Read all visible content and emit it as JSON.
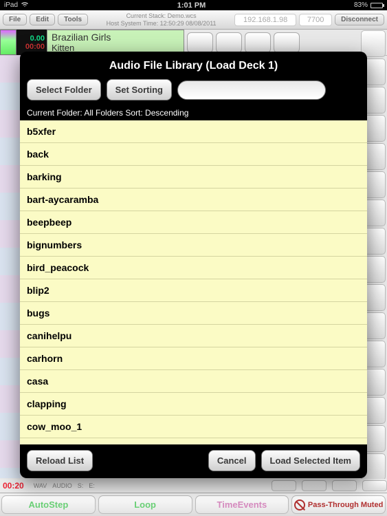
{
  "status_bar": {
    "carrier": "iPad",
    "time": "1:01 PM",
    "battery_pct": "83%"
  },
  "top_toolbar": {
    "file": "File",
    "edit": "Edit",
    "tools": "Tools",
    "stack_label": "Current Stack: Demo.wcs",
    "host_time": "Host System Time: 12:50:29  08/08/2011",
    "ip": "192.168.1.98",
    "port": "7700",
    "disconnect": "Disconnect"
  },
  "deck": {
    "elapsed": "0.00",
    "remaining": "00:00",
    "artist": "Brazilian Girls",
    "track": "Kitten"
  },
  "modal": {
    "title": "Audio File Library (Load Deck 1)",
    "select_folder": "Select Folder",
    "set_sorting": "Set Sorting",
    "search_placeholder": "",
    "meta": "Current Folder: All Folders  Sort: Descending",
    "files": [
      "b5xfer",
      "back",
      "barking",
      "bart-aycaramba",
      "beepbeep",
      "bignumbers",
      "bird_peacock",
      "blip2",
      "bugs",
      "canihelpu",
      "carhorn",
      "casa",
      "clapping",
      "cow_moo_1"
    ],
    "reload": "Reload List",
    "cancel": "Cancel",
    "load": "Load Selected Item"
  },
  "timeline": {
    "timecode": "00:20",
    "fmt": "WAV",
    "type": "AUDIO",
    "s": "S:",
    "e": "E:"
  },
  "bottom_nav": {
    "autostep": "AutoStep",
    "loop": "Loop",
    "timeevents": "TimeEvents",
    "passthrough": "Pass-Through Muted"
  }
}
